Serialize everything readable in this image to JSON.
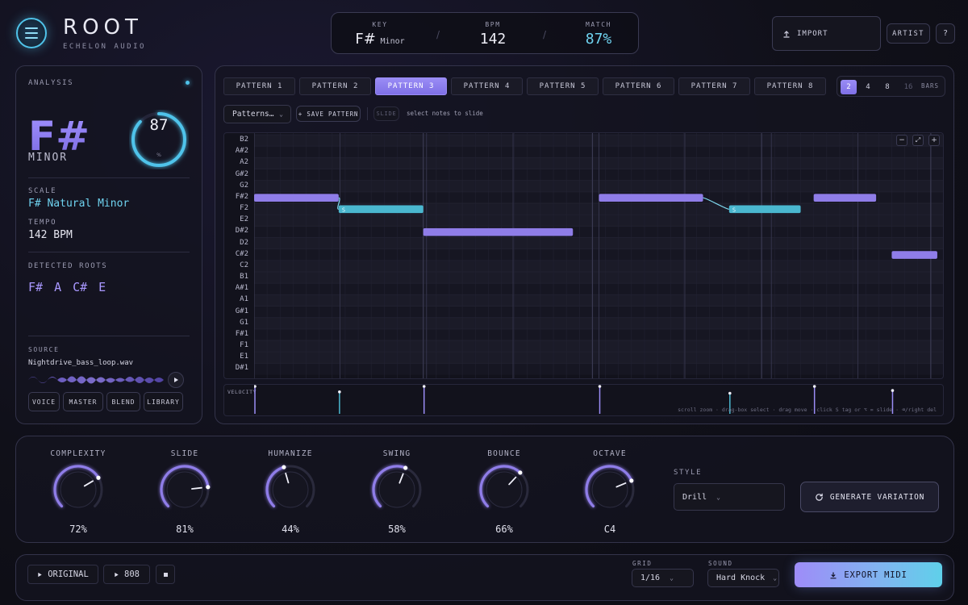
{
  "app": {
    "title": "ROOT",
    "subtitle": "ECHELON AUDIO"
  },
  "header": {
    "key_label": "KEY",
    "key_value": "F#",
    "key_mode": "Minor",
    "bpm_label": "BPM",
    "bpm_value": "142",
    "match_label": "MATCH",
    "match_value": "87%",
    "import_label": "IMPORT",
    "artist_label": "ARTIST",
    "help_label": "?"
  },
  "analysis": {
    "title": "ANALYSIS",
    "key": "F#",
    "mode": "MINOR",
    "score": "87",
    "score_unit": "%",
    "score_fraction": 0.87,
    "scale_label": "SCALE",
    "scale_value": "F# Natural Minor",
    "tempo_label": "TEMPO",
    "tempo_value": "142 BPM",
    "roots_label": "DETECTED ROOTS",
    "roots": [
      "F#",
      "A",
      "C#",
      "E"
    ],
    "source_label": "SOURCE",
    "source_file": "Nightdrive_bass_loop.wav",
    "chips": [
      "VOICE",
      "MASTER",
      "BLEND",
      "LIBRARY"
    ]
  },
  "patterns": {
    "tabs": [
      "PATTERN 1",
      "PATTERN 2",
      "PATTERN 3",
      "PATTERN 4",
      "PATTERN 5",
      "PATTERN 6",
      "PATTERN 7",
      "PATTERN 8"
    ],
    "active_index": 2,
    "bars_options": [
      "2",
      "4",
      "8",
      "16"
    ],
    "bars_selected": "2",
    "bars_label": "BARS",
    "dropdown_label": "Patterns…",
    "save_label": "+ SAVE PATTERN",
    "slide_label": "SLIDE",
    "slide_hint": "select notes to slide",
    "zoom_out": "−",
    "zoom_fit": "⤢",
    "zoom_in": "+",
    "velocity_label": "VELOCITY",
    "help_text": "scroll zoom · drag-box select · drag move · click S tag or ⌥ = slide · ⌫/right del",
    "slide_tag": "S"
  },
  "piano_roll": {
    "keys": [
      "B2",
      "A#2",
      "A2",
      "G#2",
      "G2",
      "F#2",
      "F2",
      "E2",
      "D#2",
      "D2",
      "C#2",
      "C2",
      "B1",
      "A#1",
      "A1",
      "G#1",
      "G1",
      "F#1",
      "F1",
      "E1",
      "D#1"
    ],
    "total_steps": 32,
    "notes": [
      {
        "pitch": "F#2",
        "start": 0,
        "length": 6.5,
        "slide": false,
        "velocity": 1.0
      },
      {
        "pitch": "F2",
        "start": 6.5,
        "length": 6.5,
        "slide": true,
        "velocity": 0.8
      },
      {
        "pitch": "D#2",
        "start": 13,
        "length": 11.5,
        "slide": false,
        "velocity": 1.0
      },
      {
        "pitch": "F#2",
        "start": 26.5,
        "length": 8,
        "slide": false,
        "velocity": 1.0
      },
      {
        "pitch": "F2",
        "start": 36.5,
        "length": 5.5,
        "slide": true,
        "velocity": 0.75
      },
      {
        "pitch": "F#2",
        "start": 43,
        "length": 4.8,
        "slide": false,
        "velocity": 1.0
      },
      {
        "pitch": "C#2",
        "start": 49,
        "length": 3.5,
        "slide": false,
        "velocity": 0.85
      }
    ],
    "grid_units": 53
  },
  "controls": {
    "knobs": [
      {
        "label": "COMPLEXITY",
        "value": "72%",
        "fraction": 0.72
      },
      {
        "label": "SLIDE",
        "value": "81%",
        "fraction": 0.81
      },
      {
        "label": "HUMANIZE",
        "value": "44%",
        "fraction": 0.44
      },
      {
        "label": "SWING",
        "value": "58%",
        "fraction": 0.58
      },
      {
        "label": "BOUNCE",
        "value": "66%",
        "fraction": 0.66
      },
      {
        "label": "OCTAVE",
        "value": "C4",
        "fraction": 0.75
      }
    ],
    "style_label": "STYLE",
    "style_value": "Drill",
    "generate_label": "GENERATE VARIATION"
  },
  "footer": {
    "original_label": "ORIGINAL",
    "b808_label": "808",
    "grid_label": "GRID",
    "grid_value": "1/16",
    "sound_label": "SOUND",
    "sound_value": "Hard Knock",
    "export_label": "EXPORT MIDI"
  },
  "colors": {
    "accent_purple": "#9a8cf5",
    "accent_cyan": "#4fc3ea",
    "note_purple": "#8f7de8",
    "note_cyan": "#4ab7cf"
  }
}
